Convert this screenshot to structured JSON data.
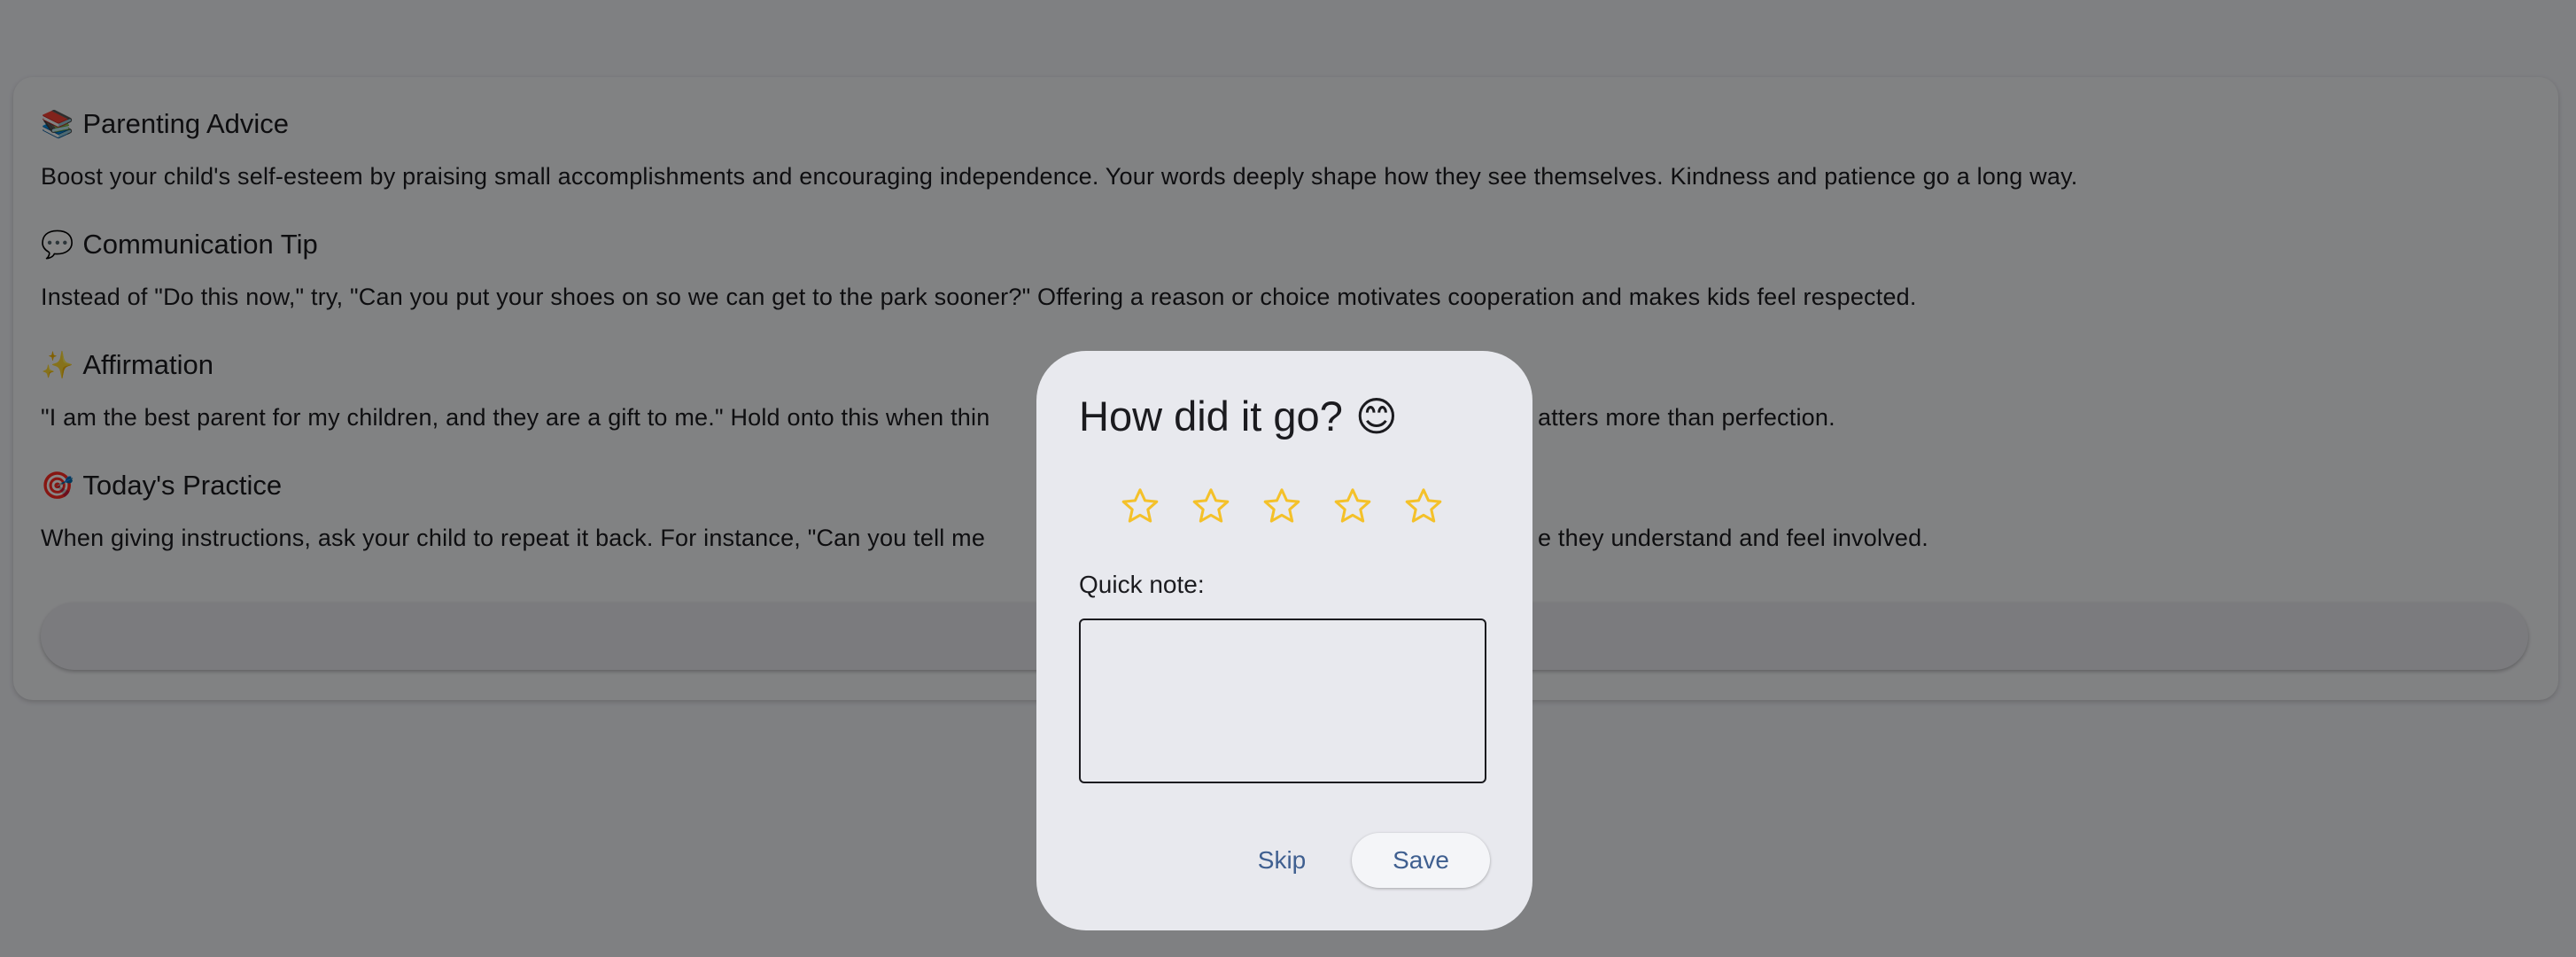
{
  "sections": [
    {
      "icon": "books-icon",
      "emoji": "📚",
      "title": "Parenting Advice",
      "body": "Boost your child's self-esteem by praising small accomplishments and encouraging independence. Your words deeply shape how they see themselves. Kindness and patience go a long way."
    },
    {
      "icon": "speech-bubble-icon",
      "emoji": "💬",
      "title": "Communication Tip",
      "body": "Instead of \"Do this now,\" try, \"Can you put your shoes on so we can get to the park sooner?\" Offering a reason or choice motivates cooperation and makes kids feel respected."
    },
    {
      "icon": "sparkles-icon",
      "emoji": "✨",
      "title": "Affirmation",
      "body": "\"I am the best parent for my children, and they are a gift to me.\" Hold onto this when thin",
      "body_tail": "atters more than perfection."
    },
    {
      "icon": "target-icon",
      "emoji": "🎯",
      "title": "Today's Practice",
      "body": "When giving instructions, ask your child to repeat it back. For instance, \"Can you tell me",
      "body_tail": "e they understand and feel involved."
    }
  ],
  "dialog": {
    "title": "How did it go?",
    "title_emoji": "😊",
    "rating": {
      "max": 5,
      "selected": 0,
      "star_color": "#f4c12a"
    },
    "note_label": "Quick note:",
    "note_value": "",
    "skip_label": "Skip",
    "save_label": "Save"
  },
  "colors": {
    "accent": "#3f5f90",
    "scrim": "rgba(0,0,0,0.47)",
    "dialog_bg": "#e8e9ee"
  }
}
